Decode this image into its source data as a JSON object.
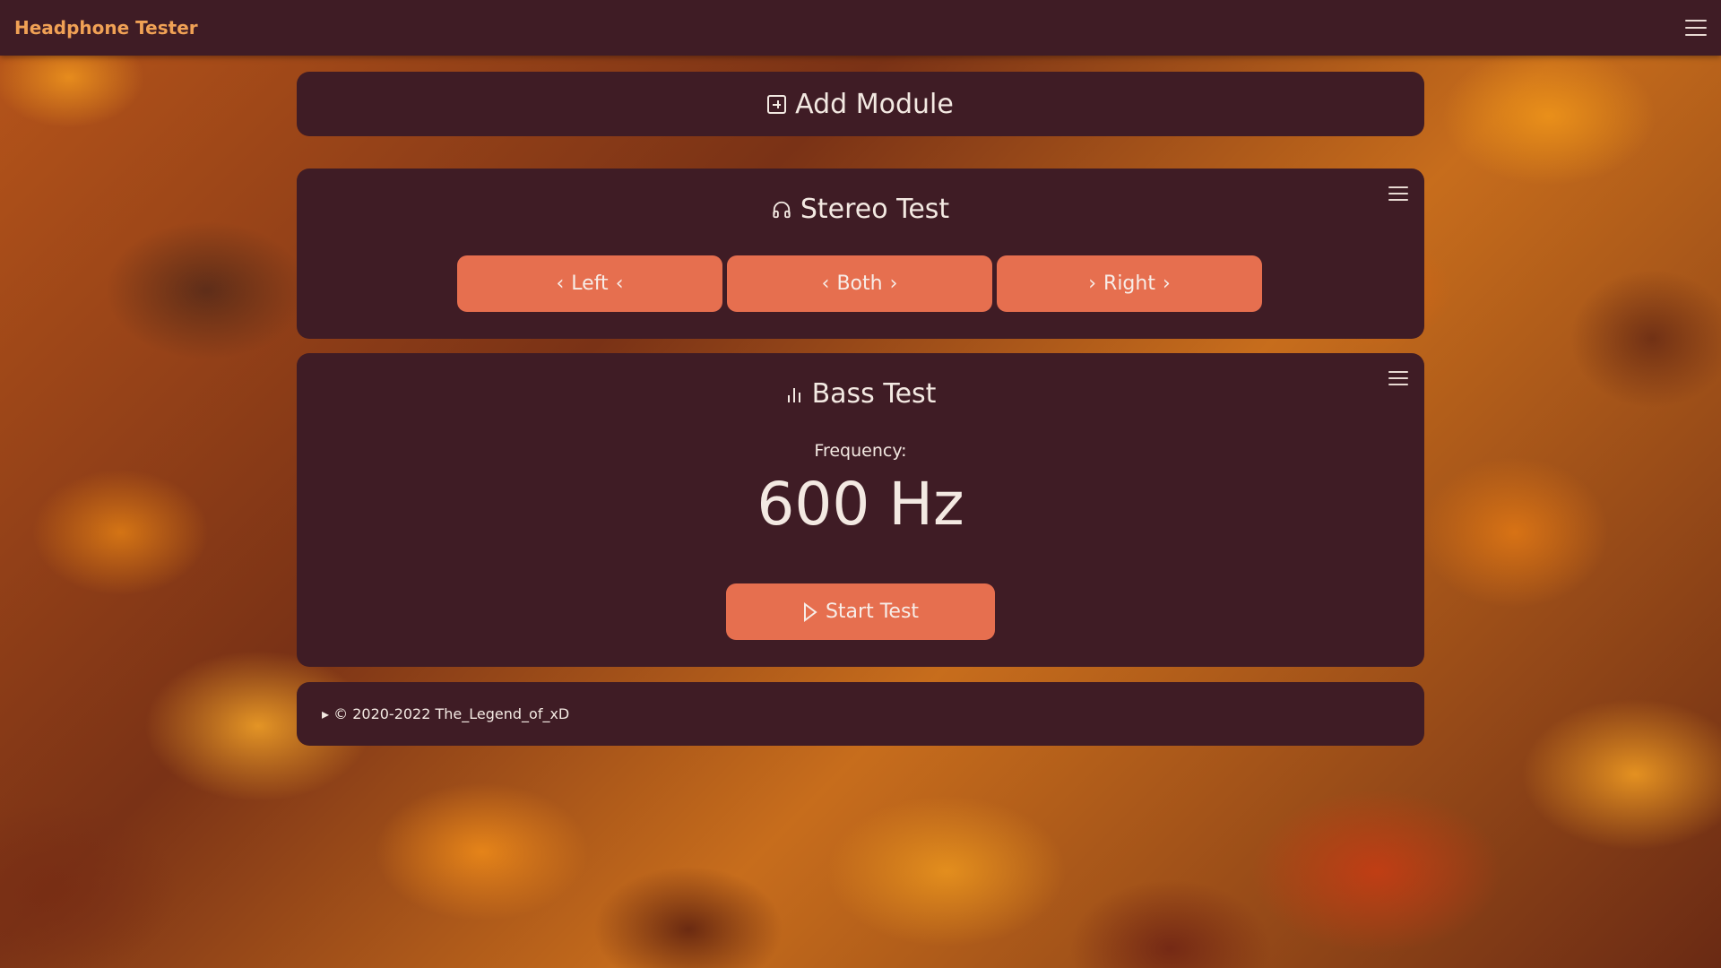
{
  "navbar": {
    "brand": "Headphone Tester",
    "menu_icon": "hamburger-menu-icon"
  },
  "add_module": {
    "label": "Add Module",
    "icon": "plus-square-icon"
  },
  "stereo_test": {
    "title": "Stereo Test",
    "icon": "headphones-icon",
    "buttons": [
      {
        "label": "Left",
        "left_chevron": "‹",
        "right_chevron": "‹"
      },
      {
        "label": "Both",
        "left_chevron": "‹",
        "right_chevron": "›"
      },
      {
        "label": "Right",
        "left_chevron": "›",
        "right_chevron": "›"
      }
    ]
  },
  "bass_test": {
    "title": "Bass Test",
    "icon": "bar-chart-icon",
    "frequency_label": "Frequency:",
    "frequency_value": "600 Hz",
    "start_button": "Start Test",
    "start_icon": "play-icon"
  },
  "footer": {
    "text": "▸ © 2020-2022 The_Legend_of_xD"
  },
  "colors": {
    "panel": "#3f1c25",
    "button": "#e66f4f",
    "brand": "#f0a155",
    "text": "#f3e9e2"
  }
}
